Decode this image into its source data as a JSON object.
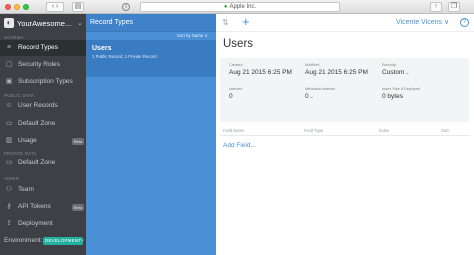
{
  "browser": {
    "address": "Apple Inc."
  },
  "sidebar": {
    "app_name": "YourAwesome...",
    "sections": {
      "schema": "SCHEMA",
      "public_data": "PUBLIC DATA",
      "private_data": "PRIVATE DATA",
      "admin": "ADMIN"
    },
    "items": [
      {
        "label": "Record Types",
        "icon": "list-icon"
      },
      {
        "label": "Security Roles",
        "icon": "lock-icon"
      },
      {
        "label": "Subscription Types",
        "icon": "subscription-icon"
      },
      {
        "label": "User Records",
        "icon": "user-icon"
      },
      {
        "label": "Default Zone",
        "icon": "zone-icon"
      },
      {
        "label": "Usage",
        "icon": "usage-icon",
        "badge": "Beta"
      },
      {
        "label": "Default Zone",
        "icon": "zone-icon"
      },
      {
        "label": "Team",
        "icon": "team-icon"
      },
      {
        "label": "API Tokens",
        "icon": "key-icon",
        "badge": "Beta"
      },
      {
        "label": "Deployment",
        "icon": "deploy-icon"
      }
    ],
    "environment_label": "Environment:",
    "environment_value": "DEVELOPMENT"
  },
  "record_types": {
    "title": "Record Types",
    "sort_label": "Sort by Name ∨",
    "items": [
      {
        "name": "Users",
        "subtitle": "1 Public Record, 1 Private Record"
      }
    ]
  },
  "main": {
    "user_name": "Vicente Vicens ∨",
    "help": "?",
    "title": "Users",
    "meta": {
      "created_label": "Created",
      "created_value": "Aug 21 2015 6:25 PM",
      "modified_label": "Modified",
      "modified_value": "Aug 21 2015 6:25 PM",
      "security_label": "Security",
      "security_value": "Custom",
      "indexes_label": "Indexes",
      "indexes_value": "0",
      "metadata_indexes_label": "Metadata Indexes",
      "metadata_indexes_value": "0",
      "deployed_label": "Index Size If Deployed",
      "deployed_value": "0 bytes"
    },
    "field_headers": [
      "Field Name",
      "Field Type",
      "Index",
      "Sort"
    ],
    "add_field": "Add Field..."
  },
  "colors": {
    "sidebar_bg": "#3d4145",
    "record_column_bg": "#4a90d6",
    "accent": "#4a90d6",
    "environment_pill": "#22b0a0"
  }
}
